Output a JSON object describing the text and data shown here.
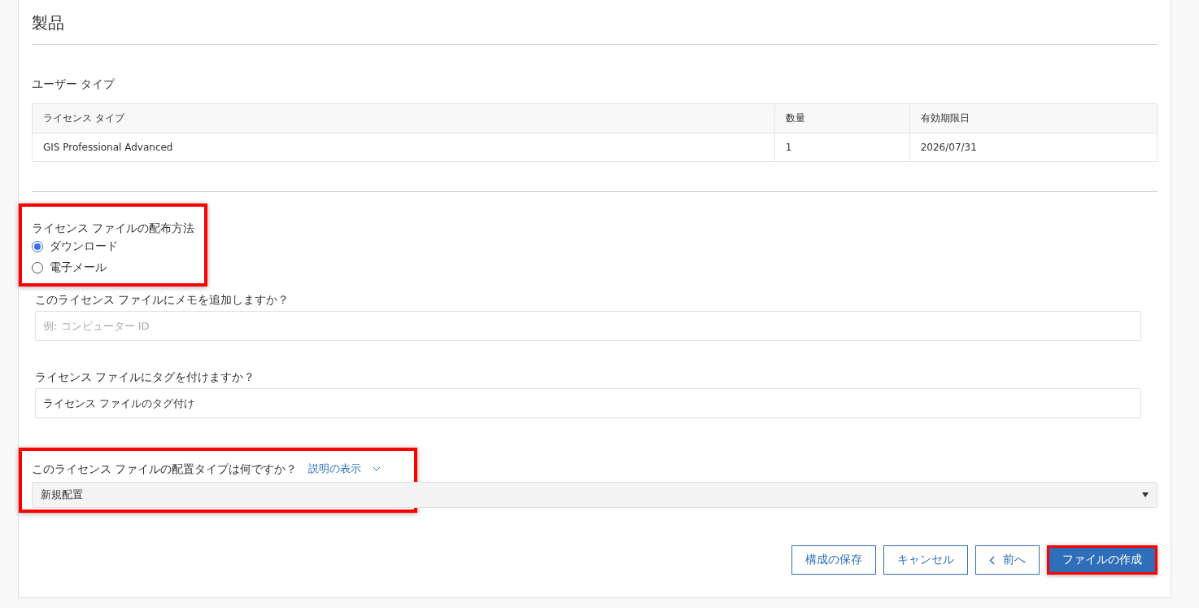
{
  "section_title": "製品",
  "user_type": {
    "label": "ユーザー タイプ",
    "columns": [
      "ライセンス タイプ",
      "数量",
      "有効期限日"
    ],
    "rows": [
      [
        "GIS Professional Advanced",
        "1",
        "2026/07/31"
      ]
    ]
  },
  "distribution": {
    "highlighted": true,
    "label": "ライセンス ファイルの配布方法",
    "options": [
      {
        "label": "ダウンロード",
        "selected": true
      },
      {
        "label": "電子メール",
        "selected": false
      }
    ]
  },
  "memo": {
    "highlighted": false,
    "label": "このライセンス ファイルにメモを追加しますか？",
    "placeholder": "例: コンピューター ID"
  },
  "tag": {
    "highlighted": false,
    "label": "ライセンス ファイルにタグを付けますか？",
    "value": "ライセンス ファイルのタグ付け"
  },
  "deployment": {
    "highlighted": true,
    "label": "このライセンス ファイルの配置タイプは何ですか？",
    "help_link": "説明の表示",
    "value": "新規配置"
  },
  "buttons": [
    {
      "label": "構成の保存",
      "kind": "outline",
      "highlighted": false
    },
    {
      "label": "キャンセル",
      "kind": "outline",
      "highlighted": false
    },
    {
      "label": "前へ",
      "kind": "back",
      "highlighted": false
    },
    {
      "label": "ファイルの作成",
      "kind": "primary",
      "highlighted": true
    }
  ]
}
